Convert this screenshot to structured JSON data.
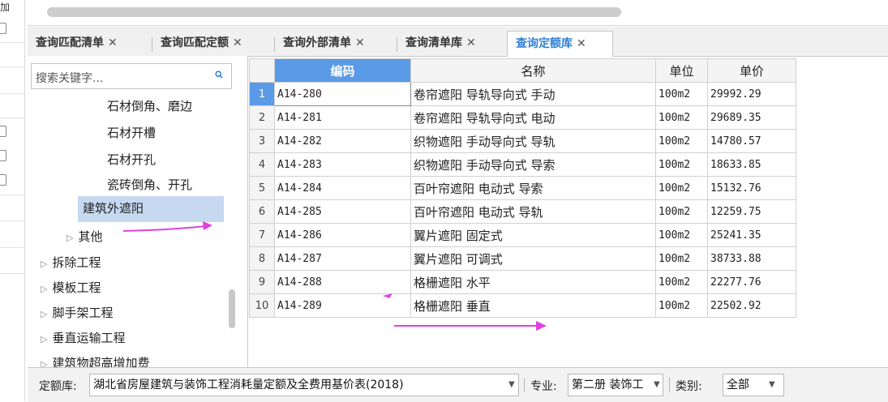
{
  "left_strip": {
    "label": "加"
  },
  "tabs": [
    {
      "label": "查询匹配清单",
      "active": false
    },
    {
      "label": "查询匹配定额",
      "active": false
    },
    {
      "label": "查询外部清单",
      "active": false
    },
    {
      "label": "查询清单库",
      "active": false
    },
    {
      "label": "查询定额库",
      "active": true
    }
  ],
  "tab_close": "✕",
  "search": {
    "placeholder": "搜索关键字..."
  },
  "tree": {
    "items": [
      {
        "label": "石材倒角、磨边"
      },
      {
        "label": "石材开槽"
      },
      {
        "label": "石材开孔"
      },
      {
        "label": "瓷砖倒角、开孔"
      },
      {
        "label": "建筑外遮阳",
        "selected": true
      },
      {
        "label": "其他",
        "expander": "▷"
      },
      {
        "label": "拆除工程",
        "expander": "▷"
      },
      {
        "label": "模板工程",
        "expander": "▷"
      },
      {
        "label": "脚手架工程",
        "expander": "▷"
      },
      {
        "label": "垂直运输工程",
        "expander": "▷"
      },
      {
        "label": "建筑物超高增加费",
        "expander": "▷"
      }
    ]
  },
  "grid": {
    "columns": [
      "编码",
      "名称",
      "单位",
      "单价"
    ],
    "rows": [
      {
        "num": "1",
        "code": "A14-280",
        "name": "卷帘遮阳 导轨导向式 手动",
        "unit": "100m2",
        "price": "29992.29"
      },
      {
        "num": "2",
        "code": "A14-281",
        "name": "卷帘遮阳 导轨导向式 电动",
        "unit": "100m2",
        "price": "29689.35"
      },
      {
        "num": "3",
        "code": "A14-282",
        "name": "织物遮阳 手动导向式 导轨",
        "unit": "100m2",
        "price": "14780.57"
      },
      {
        "num": "4",
        "code": "A14-283",
        "name": "织物遮阳 手动导向式 导索",
        "unit": "100m2",
        "price": "18633.85"
      },
      {
        "num": "5",
        "code": "A14-284",
        "name": "百叶帘遮阳 电动式 导索",
        "unit": "100m2",
        "price": "15132.76"
      },
      {
        "num": "6",
        "code": "A14-285",
        "name": "百叶帘遮阳 电动式 导轨",
        "unit": "100m2",
        "price": "12259.75"
      },
      {
        "num": "7",
        "code": "A14-286",
        "name": "翼片遮阳 固定式",
        "unit": "100m2",
        "price": "25241.35"
      },
      {
        "num": "8",
        "code": "A14-287",
        "name": "翼片遮阳 可调式",
        "unit": "100m2",
        "price": "38733.88"
      },
      {
        "num": "9",
        "code": "A14-288",
        "name": "格栅遮阳 水平",
        "unit": "100m2",
        "price": "22277.76"
      },
      {
        "num": "10",
        "code": "A14-289",
        "name": "格栅遮阳 垂直",
        "unit": "100m2",
        "price": "22502.92"
      }
    ]
  },
  "bottom": {
    "quota_label": "定额库:",
    "quota_value": "湖北省房屋建筑与装饰工程消耗量定额及全费用基价表(2018)",
    "major_label": "专业:",
    "major_value": "第二册 装饰工",
    "category_label": "类别:",
    "category_value": "全部"
  },
  "colors": {
    "accent": "#2f7fd6",
    "header_highlight": "#5a9ae6",
    "selected_row": "#c6d9f1",
    "annotation_arrow": "#e040e0"
  }
}
